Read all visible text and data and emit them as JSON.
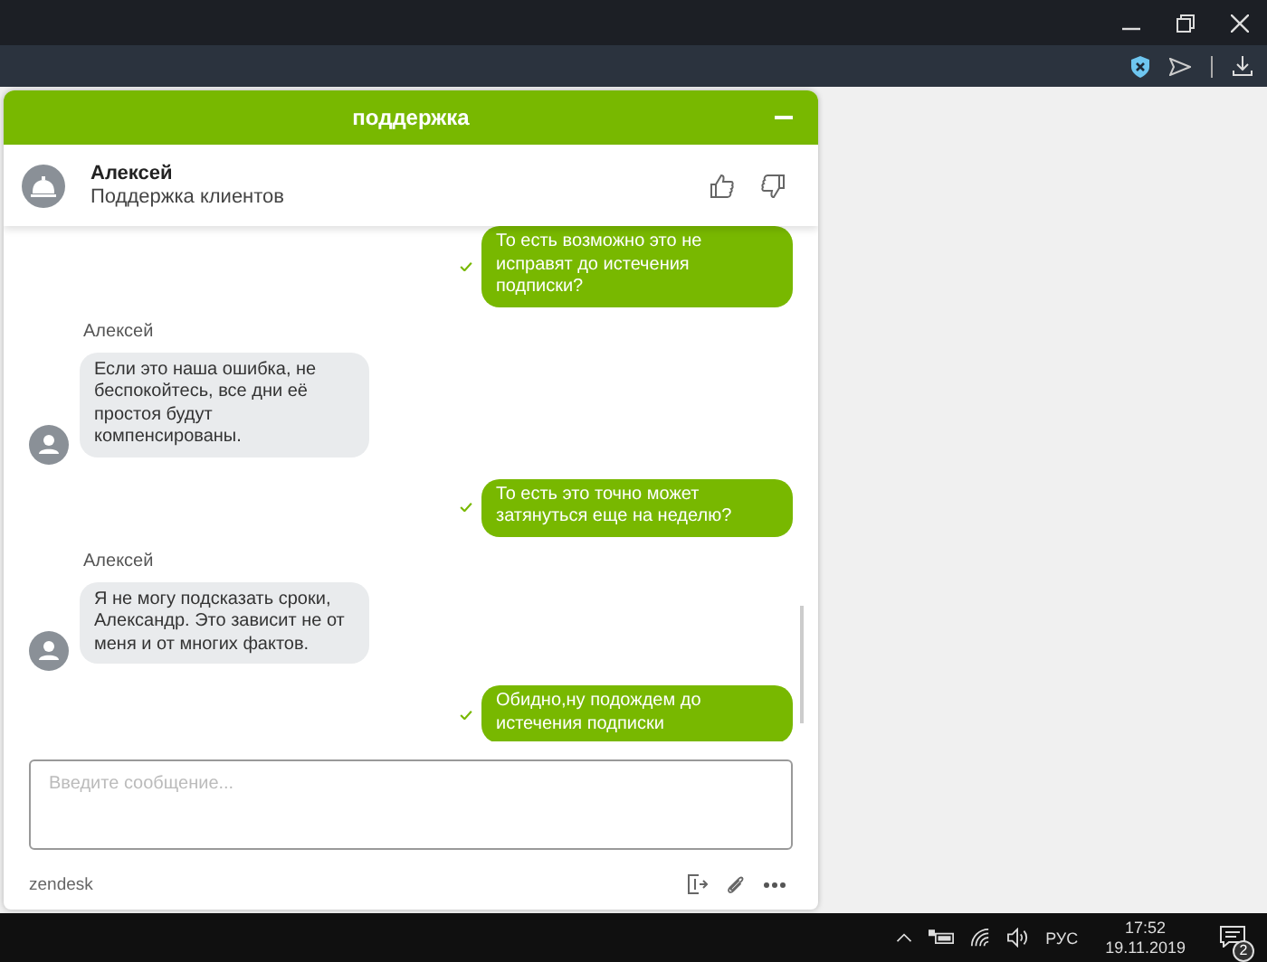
{
  "widget": {
    "title": "поддержка",
    "agent": {
      "name": "Алексей",
      "role": "Поддержка клиентов"
    },
    "messages": [
      {
        "kind": "outgoing",
        "text": "То есть возможно это не исправят до истечения подписки?",
        "delivered": true
      },
      {
        "kind": "incoming",
        "author": "Алексей",
        "text": "Если это наша ошибка, не беспокойтесь, все дни её простоя будут компенсированы."
      },
      {
        "kind": "outgoing",
        "text": "То есть это точно может затянуться еще на неделю?",
        "delivered": true
      },
      {
        "kind": "incoming",
        "author": "Алексей",
        "text": "Я не могу подсказать сроки, Александр. Это зависит не от меня и от многих фактов."
      },
      {
        "kind": "outgoing",
        "text": "Обидно,ну подождем до истечения подписки",
        "delivered": true
      }
    ],
    "input": {
      "placeholder": "Введите сообщение..."
    },
    "brand": "zendesk"
  },
  "taskbar": {
    "language": "РУС",
    "time": "17:52",
    "date": "19.11.2019",
    "notifications": "2"
  }
}
